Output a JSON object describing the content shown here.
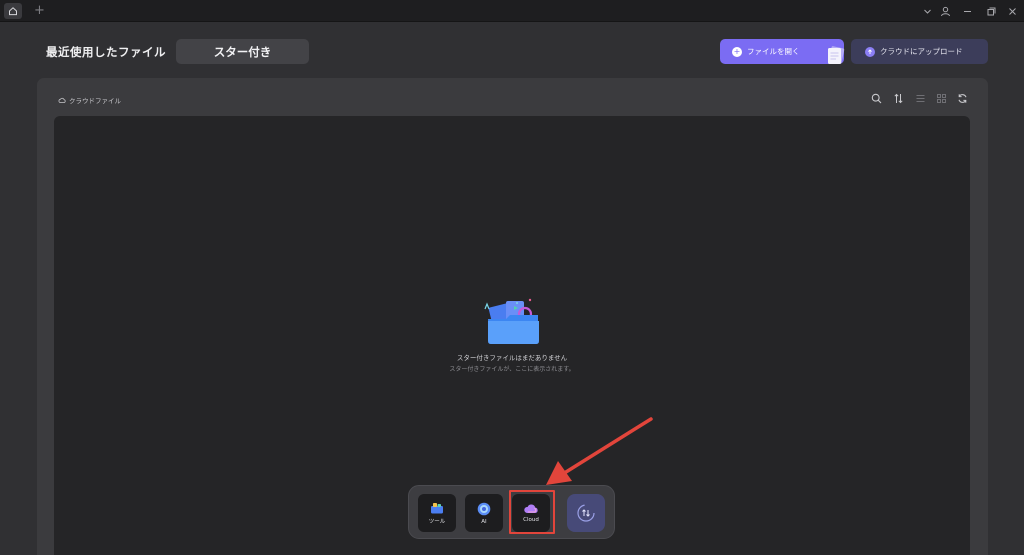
{
  "titlebar": {
    "home_icon": "home-icon",
    "new_tab_glyph": "+",
    "controls": [
      "chevron-down-icon",
      "user-icon",
      "minimize-icon",
      "restore-icon",
      "close-icon"
    ]
  },
  "header": {
    "title": "最近使用したファイル",
    "tab_starred": "スター付き",
    "open_file_label": "ファイルを開く",
    "upload_label": "クラウドにアップロード"
  },
  "panel": {
    "breadcrumb": "クラウドファイル",
    "toolbar_icons": [
      "search-icon",
      "sort-icon",
      "list-view-icon",
      "grid-view-icon",
      "refresh-icon"
    ]
  },
  "empty_state": {
    "title": "スター付きファイルはまだありません",
    "subtitle": "スター付きファイルが、ここに表示されます。"
  },
  "dock": {
    "items": [
      {
        "label": "ツール",
        "icon": "tools-icon"
      },
      {
        "label": "AI",
        "icon": "ai-icon"
      },
      {
        "label": "Cloud",
        "icon": "cloud-icon"
      }
    ],
    "extra_icon": "sync-icon"
  },
  "colors": {
    "accent": "#7b6cf3",
    "upload_bg": "#3c3d5a",
    "highlight": "#e2453b"
  }
}
